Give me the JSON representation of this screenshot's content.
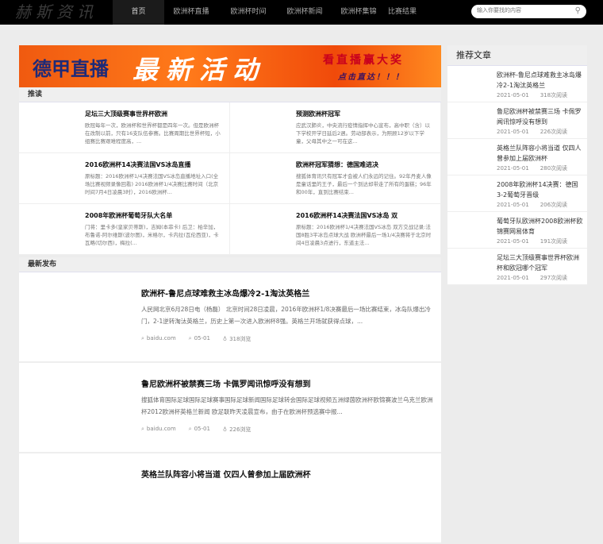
{
  "nav": {
    "logo": "赫斯资讯",
    "items": [
      "首页",
      "欧洲杯直播",
      "欧洲杯时间",
      "欧洲杯新闻",
      "欧洲杯集锦",
      "比赛结果"
    ],
    "search_placeholder": "输入你要找的内容"
  },
  "banner": {
    "left": "德甲直播",
    "main": "最新活动",
    "right": "看直播赢大奖",
    "sub": "点击直达！！！"
  },
  "recommend_read": {
    "title": "推读",
    "items": [
      {
        "title": "足坛三大顶级赛事世界杯欧洲",
        "desc": "欧冠每年一次，欧洲杯和世界杯都是四年一次。但是欧洲杯在改制以前，只有16支队伍参赛。比赛周期比世界杯短，小组赛比赛艰难程度高，..."
      },
      {
        "title": "2016欧洲杯14决赛法国VS冰岛直播",
        "desc": "原标题：2016欧洲杯1/4决赛法国VS冰岛直播地址入口(全场比赛视频录像回看) 2016欧洲杯1/4决赛比赛时间（北京时间7月4日凌晨3时），2016欧洲杯..."
      },
      {
        "title": "2008年欧洲杯葡萄牙队大名单",
        "desc": "门将：里卡多(皇家贝蒂斯)，吉姆(本菲卡) 后卫：柏辛加，布鲁诺-阿尔维斯(波尔图)，米格尔，卡内拉(瓦伦西亚)，卡瓦略(切尔西)，梅拉(..."
      },
      {
        "title": "预测欧洲杯冠军",
        "desc": "应武汉肺炎，中央流行疫情指挥中心宣布，高中职（含）以下学校开学日延后2週。劳动部表示，为照顾12岁以下学童，父母其中之一可在这..."
      },
      {
        "title": "欧洲杯冠军猜想：德国难进决",
        "desc": "搜狐体育讯只有冠军才会被人们永远的记住。92年丹麦人像是童话里的王子，最后一个到达却带走了所有的蛋糕；96年和00年，直到比赛结束..."
      },
      {
        "title": "2016欧洲杯14决赛法国VS冰岛 双",
        "desc": "原标题：2016欧洲杯1/4决赛法国VS冰岛 双方交战记录:法国8胜3平冰岛点球大战 欧洲杯最后一场1/4决赛将于北京时间4日凌晨3点进行，东道主法..."
      }
    ]
  },
  "latest": {
    "title": "最新发布",
    "items": [
      {
        "title": "欧洲杯-鲁尼点球难救主冰岛爆冷2-1淘汰英格兰",
        "desc": "人民网北京6月28日电（杨磊） 北京时间28日凌晨，2016年欧洲杯1/8决赛最后一场比赛结束，冰岛队爆出冷门，2-1逆转淘汰英格兰，历史上第一次进入欧洲杯8强。英格兰开场就获得点球，...",
        "source": "baidu.com",
        "date": "05-01",
        "views": "318浏览"
      },
      {
        "title": "鲁尼欧洲杯被禁赛三场 卡佩罗闻讯惊呼没有想到",
        "desc": "搜狐体育国际足球国际足球赛事国际足球新闻国际足球转会国际足球视频五洲绿茵欧洲杯欧锦赛波兰乌克兰欧洲杯2012欧洲杯英格兰新闻 欧足联昨天凌晨宣布，由于在欧洲杯预选赛中报...",
        "source": "baidu.com",
        "date": "05-01",
        "views": "226浏览"
      },
      {
        "title": "英格兰队阵容小将当道 仅四人曾参加上届欧洲杯",
        "desc": "",
        "source": "",
        "date": "",
        "views": ""
      }
    ]
  },
  "sidebar": {
    "title": "推荐文章",
    "items": [
      {
        "title": "欧洲杯-鲁尼点球难救主冰岛爆冷2-1淘汰英格兰",
        "date": "2021-05-01",
        "reads": "318次阅读"
      },
      {
        "title": "鲁尼欧洲杯被禁赛三场 卡佩罗闻讯惊呼没有想到",
        "date": "2021-05-01",
        "reads": "226次阅读"
      },
      {
        "title": "英格兰队阵容小将当道 仅四人曾参加上届欧洲杯",
        "date": "2021-05-01",
        "reads": "280次阅读"
      },
      {
        "title": "2008年欧洲杯14决赛：德国3-2葡萄牙晋级",
        "date": "2021-05-01",
        "reads": "206次阅读"
      },
      {
        "title": "葡萄牙队欧洲杯2008欧洲杯欧锦赛网易体育",
        "date": "2021-05-01",
        "reads": "191次阅读"
      },
      {
        "title": "足坛三大顶级赛事世界杯欧洲杯和欧冠哪个冠军",
        "date": "2021-05-01",
        "reads": "297次阅读"
      }
    ]
  }
}
